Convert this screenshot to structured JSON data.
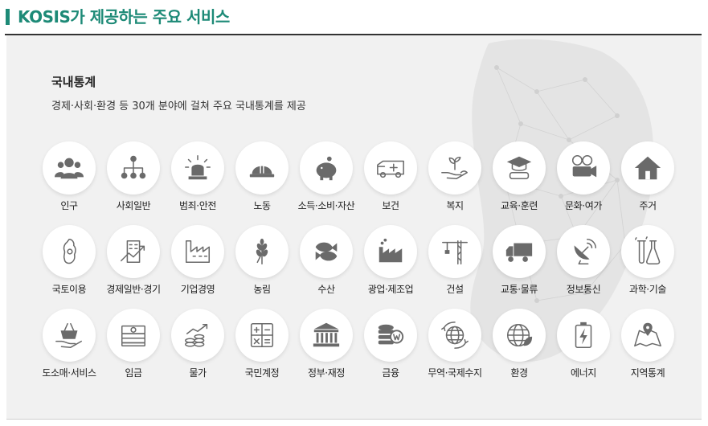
{
  "header": {
    "title": "KOSIS가 제공하는 주요 서비스"
  },
  "section": {
    "title": "국내통계",
    "description": "경제·사회·환경 등 30개 분야에 걸쳐 주요 국내통계를 제공"
  },
  "categories": [
    {
      "label": "인구",
      "icon": "population-icon"
    },
    {
      "label": "사회일반",
      "icon": "org-chart-icon"
    },
    {
      "label": "범죄·안전",
      "icon": "siren-icon"
    },
    {
      "label": "노동",
      "icon": "hard-hat-icon"
    },
    {
      "label": "소득·소비·자산",
      "icon": "piggy-bank-icon"
    },
    {
      "label": "보건",
      "icon": "ambulance-icon"
    },
    {
      "label": "복지",
      "icon": "hand-sprout-icon"
    },
    {
      "label": "교육·훈련",
      "icon": "graduation-cap-icon"
    },
    {
      "label": "문화·여가",
      "icon": "film-camera-icon"
    },
    {
      "label": "주거",
      "icon": "house-icon"
    },
    {
      "label": "국토이용",
      "icon": "korea-map-icon"
    },
    {
      "label": "경제일반·경기",
      "icon": "building-chart-icon"
    },
    {
      "label": "기업경영",
      "icon": "factory-outline-icon"
    },
    {
      "label": "농림",
      "icon": "wheat-icon"
    },
    {
      "label": "수산",
      "icon": "fish-icon"
    },
    {
      "label": "광업·제조업",
      "icon": "factory-icon"
    },
    {
      "label": "건설",
      "icon": "crane-icon"
    },
    {
      "label": "교통·물류",
      "icon": "truck-icon"
    },
    {
      "label": "정보통신",
      "icon": "satellite-dish-icon"
    },
    {
      "label": "과학·기술",
      "icon": "flask-icon"
    },
    {
      "label": "도소매·서비스",
      "icon": "shopping-basket-icon"
    },
    {
      "label": "임금",
      "icon": "cash-stack-icon"
    },
    {
      "label": "물가",
      "icon": "coins-chart-icon"
    },
    {
      "label": "국민계정",
      "icon": "calculator-icon"
    },
    {
      "label": "정부·재정",
      "icon": "government-building-icon"
    },
    {
      "label": "금융",
      "icon": "coin-stack-icon"
    },
    {
      "label": "무역·국제수지",
      "icon": "globe-arrows-icon"
    },
    {
      "label": "환경",
      "icon": "globe-leaf-icon"
    },
    {
      "label": "에너지",
      "icon": "battery-icon"
    },
    {
      "label": "지역통계",
      "icon": "map-pin-icon"
    }
  ],
  "colors": {
    "accent": "#1d8a77",
    "icon": "#6a6a6a",
    "panel_bg": "#f1f1f1"
  }
}
